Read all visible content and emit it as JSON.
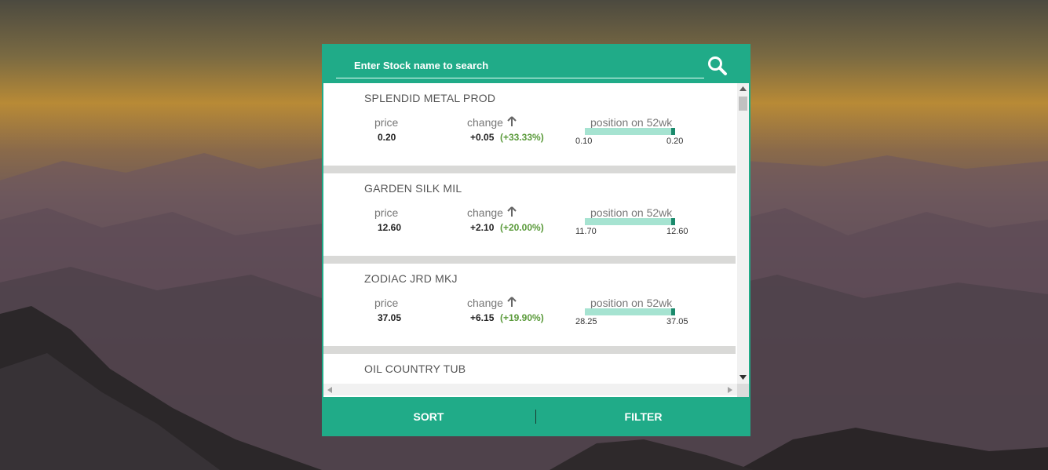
{
  "search": {
    "placeholder": "Enter Stock name to search"
  },
  "labels": {
    "price": "price",
    "change": "change",
    "position": "position on 52wk"
  },
  "stocks": [
    {
      "name": "SPLENDID METAL PROD",
      "price": "0.20",
      "change": "+0.05",
      "change_pct": "(+33.33%)",
      "low": "0.10",
      "high": "0.20",
      "position_52wk": 1.0
    },
    {
      "name": "GARDEN SILK MIL",
      "price": "12.60",
      "change": "+2.10",
      "change_pct": "(+20.00%)",
      "low": "11.70",
      "high": "12.60",
      "position_52wk": 1.0
    },
    {
      "name": "ZODIAC JRD MKJ",
      "price": "37.05",
      "change": "+6.15",
      "change_pct": "(+19.90%)",
      "low": "28.25",
      "high": "37.05",
      "position_52wk": 1.0
    },
    {
      "name": "OIL COUNTRY TUB"
    }
  ],
  "footer": {
    "sort_label": "SORT",
    "filter_label": "FILTER"
  },
  "colors": {
    "accent": "#20ab88",
    "bar_fill": "#a6e3d1",
    "bar_marker": "#1b8a6c",
    "positive": "#5a9a3a"
  },
  "icons": {
    "search": "search-icon",
    "up": "arrow-up-icon"
  }
}
